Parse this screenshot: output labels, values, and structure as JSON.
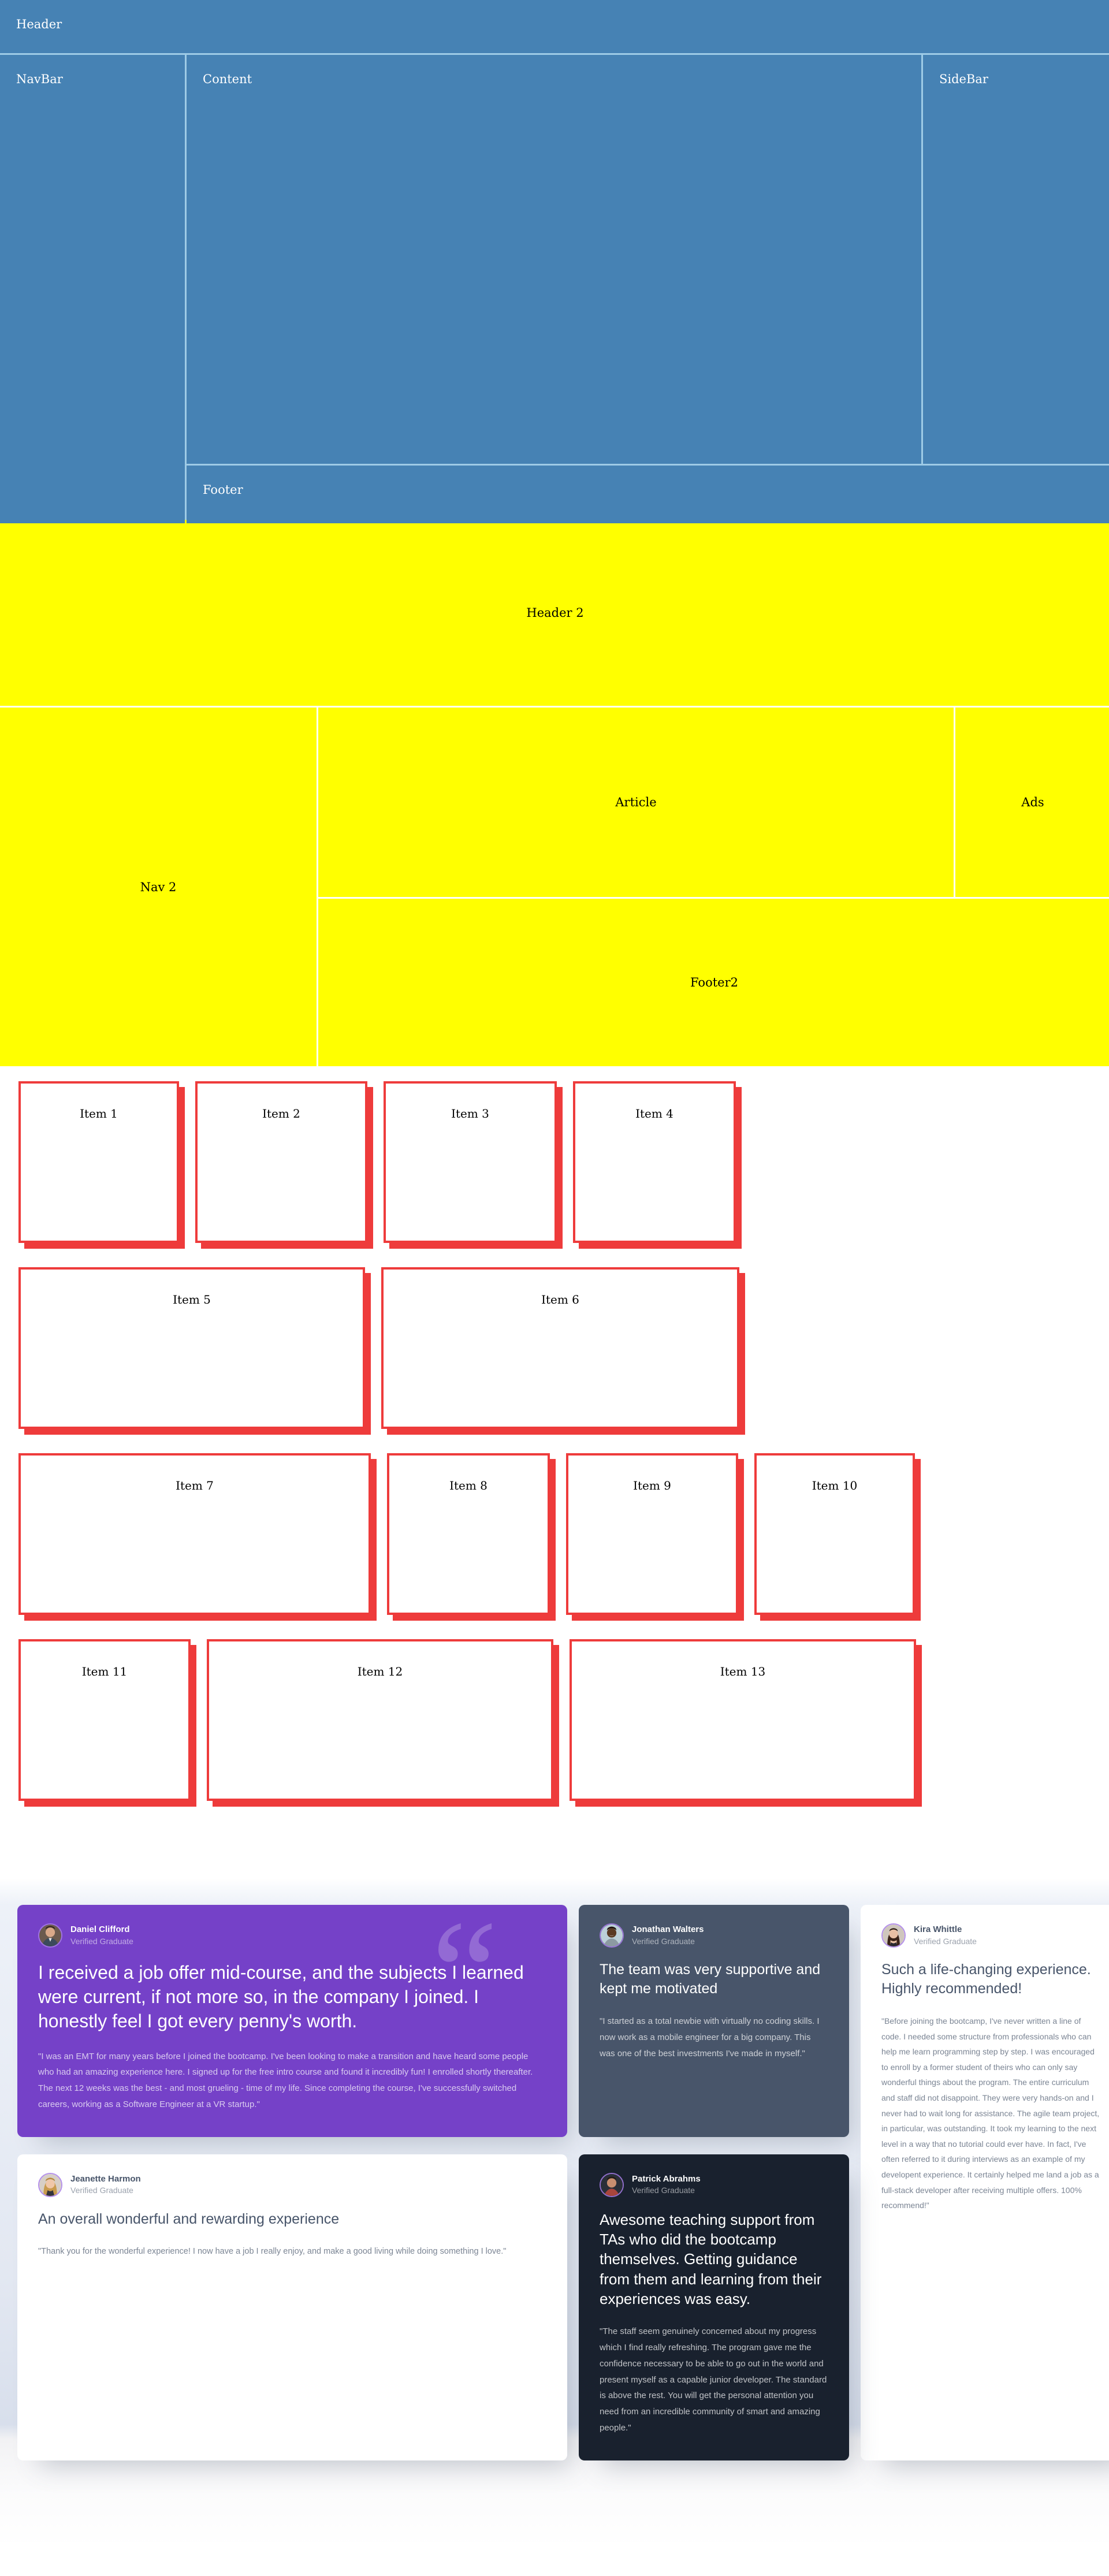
{
  "blue_layout": {
    "header": "Header",
    "navbar": "NavBar",
    "content": "Content",
    "sidebar": "SideBar",
    "footer": "Footer"
  },
  "yellow_layout": {
    "header": "Header 2",
    "nav": "Nav 2",
    "article": "Article",
    "ads": "Ads",
    "footer": "Footer2"
  },
  "flex_items": [
    {
      "label": "Item 1"
    },
    {
      "label": "Item 2"
    },
    {
      "label": "Item 3"
    },
    {
      "label": "Item 4"
    },
    {
      "label": "Item 5"
    },
    {
      "label": "Item 6"
    },
    {
      "label": "Item 7"
    },
    {
      "label": "Item 8"
    },
    {
      "label": "Item 9"
    },
    {
      "label": "Item 10"
    },
    {
      "label": "Item 11"
    },
    {
      "label": "Item 12"
    },
    {
      "label": "Item 13"
    }
  ],
  "colors": {
    "blue_panel": "#4682B4",
    "blue_border": "#9ECBE6",
    "yellow_panel": "#FFFF00",
    "item_border": "#EE3B3B",
    "testimonial_purple": "#7541C8",
    "testimonial_grayblue": "#48556A",
    "testimonial_darknavy": "#19212E",
    "testimonial_white": "#FFFFFF",
    "testimonial_bg": "#ECF1F8"
  },
  "testimonials": [
    {
      "name": "Daniel Clifford",
      "role": "Verified Graduate",
      "headline": "I received a job offer mid-course, and the subjects I learned were current, if not more so, in the company I joined. I honestly feel I got every penny's worth.",
      "quote": "\"I was an EMT for many years before I joined the bootcamp. I've been looking to make a transition and have heard some people who had an amazing experience here. I signed up for the free intro course and found it incredibly fun! I enrolled shortly thereafter. The next 12 weeks was the best - and most grueling - time of my life. Since completing the course, I've successfully switched careers, working as a Software Engineer at a VR startup.\"",
      "quote_mark": "“"
    },
    {
      "name": "Jonathan Walters",
      "role": "Verified Graduate",
      "headline": "The team was very supportive and kept me motivated",
      "quote": "\"I started as a total newbie with virtually no coding skills. I now work as a mobile engineer for a big company. This was one of the best investments I've made in myself.\""
    },
    {
      "name": "Kira Whittle",
      "role": "Verified Graduate",
      "headline": "Such a life-changing experience. Highly recommended!",
      "quote": "\"Before joining the bootcamp, I've never written a line of code. I needed some structure from professionals who can help me learn programming step by step. I was encouraged to enroll by a former student of theirs who can only say wonderful things about the program. The entire curriculum and staff did not disappoint. They were very hands-on and I never had to wait long for assistance. The agile team project, in particular, was outstanding. It took my learning to the next level in a way that no tutorial could ever have. In fact, I've often referred to it during interviews as an example of my developent experience. It certainly helped me land a job as a full-stack developer after receiving multiple offers. 100% recommend!\""
    },
    {
      "name": "Jeanette Harmon",
      "role": "Verified Graduate",
      "headline": "An overall wonderful and rewarding experience",
      "quote": "\"Thank you for the wonderful experience! I now have a job I really enjoy, and make a good living while doing something I love.\""
    },
    {
      "name": "Patrick Abrahms",
      "role": "Verified Graduate",
      "headline": "Awesome teaching support from TAs who did the bootcamp themselves. Getting guidance from them and learning from their experiences was easy.",
      "quote": "\"The staff seem genuinely concerned about my progress which I find really refreshing. The program gave me the confidence necessary to be able to go out in the world and present myself as a capable junior developer. The standard is above the rest. You will get the personal attention you need from an incredible community of smart and amazing people.\""
    }
  ]
}
